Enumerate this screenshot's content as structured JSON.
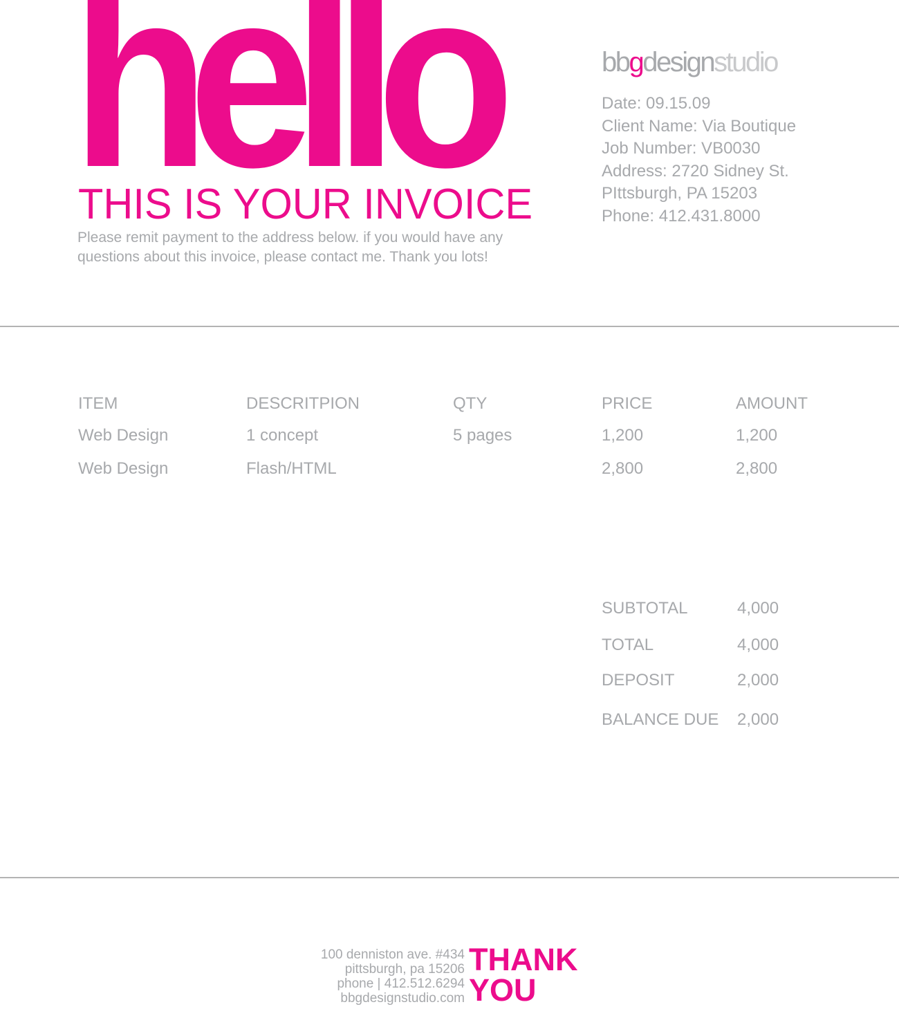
{
  "header": {
    "hello": "hello",
    "headline": "THIS IS YOUR INVOICE",
    "intro_lines": [
      "Please remit payment to the address below. if you would have any",
      "questions about this invoice, please contact me. Thank you lots!"
    ]
  },
  "studio": {
    "logo_parts": [
      "bb",
      "g",
      "design",
      "studio"
    ],
    "meta": [
      "Date: 09.15.09",
      "Client Name: Via Boutique",
      "Job Number: VB0030",
      "Address: 2720 Sidney St.",
      "PIttsburgh, PA 15203",
      "Phone: 412.431.8000"
    ]
  },
  "table": {
    "headers": [
      "ITEM",
      "DESCRITPION",
      "QTY",
      "PRICE",
      "AMOUNT"
    ],
    "rows": [
      [
        "Web Design",
        "1 concept",
        "5 pages",
        "1,200",
        "1,200"
      ],
      [
        "Web Design",
        "Flash/HTML",
        "",
        "2,800",
        "2,800"
      ]
    ]
  },
  "totals": [
    {
      "label": "SUBTOTAL",
      "value": "4,000"
    },
    {
      "label": "TOTAL",
      "value": "4,000"
    },
    {
      "label": "DEPOSIT",
      "value": "2,000"
    },
    {
      "label": "BALANCE DUE",
      "value": "2,000"
    }
  ],
  "footer": {
    "address_lines": [
      "100 denniston ave. #434",
      "pittsburgh, pa 15206",
      "phone | 412.512.6294",
      "bbgdesignstudio.com"
    ],
    "thanks_lines": [
      "THANK",
      "YOU"
    ]
  },
  "colors": {
    "accent": "#ec0c8c",
    "text_gray": "#a7a9ac",
    "rule_gray": "#b3b3b3"
  }
}
